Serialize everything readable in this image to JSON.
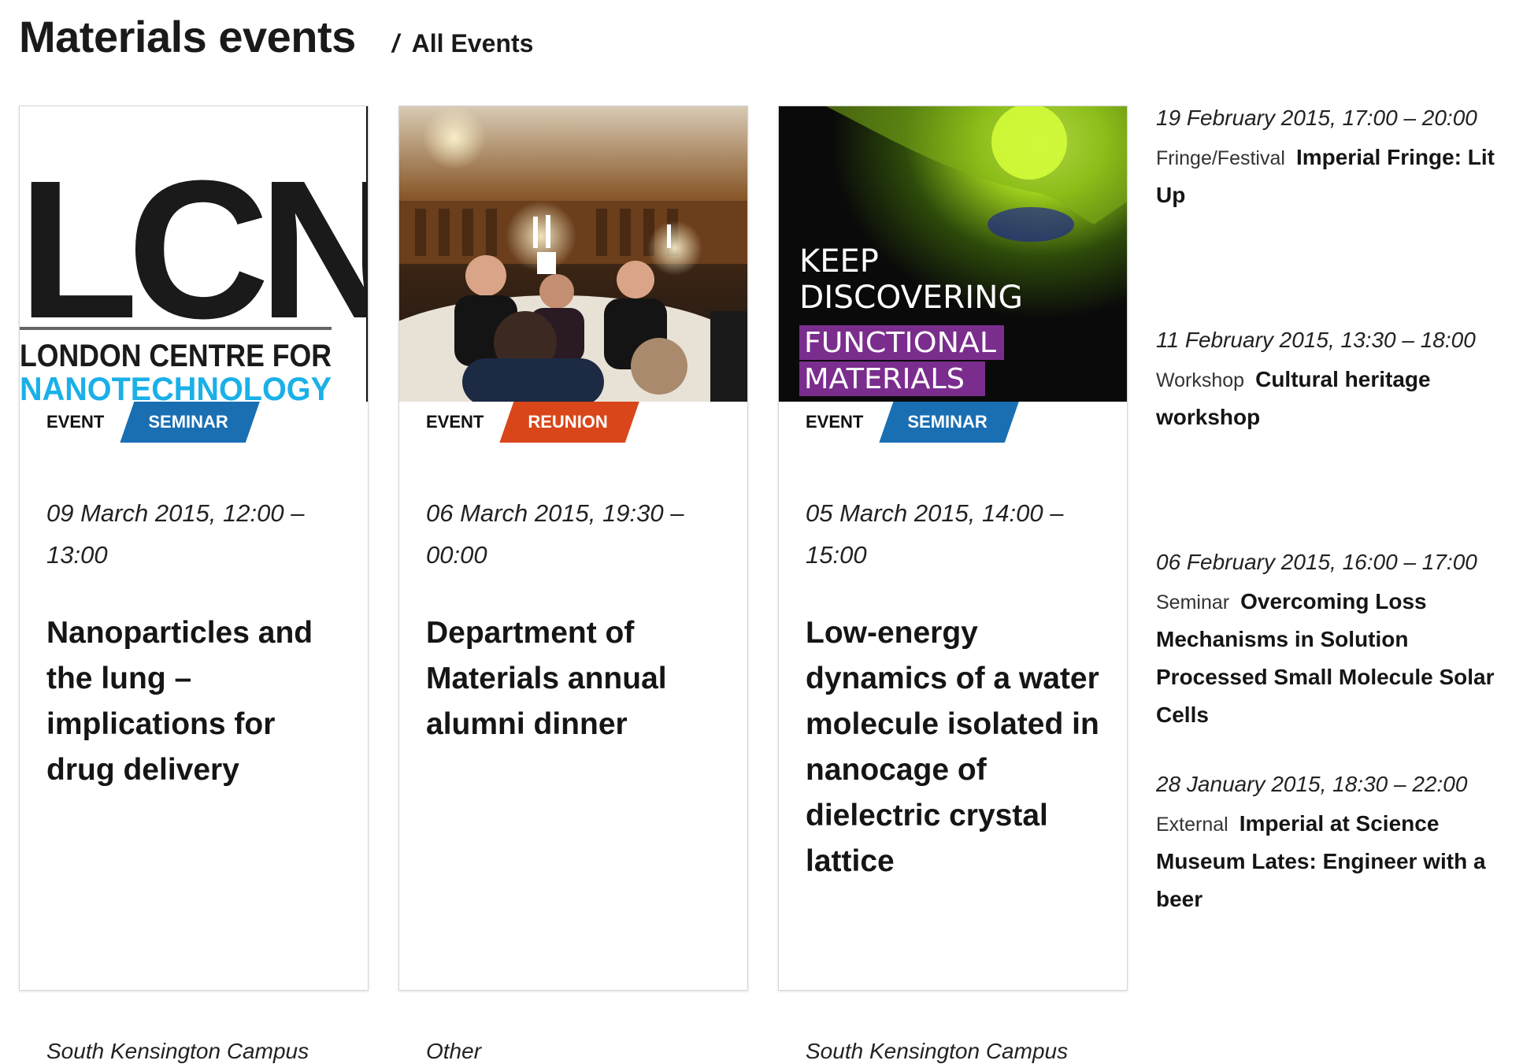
{
  "header": {
    "title": "Materials events",
    "separator": "/",
    "breadcrumb_link": "All Events"
  },
  "cards": [
    {
      "image_text": {
        "line1": "LCN",
        "line2": "LONDON CENTRE FOR",
        "line3": "NANOTECHNOLOGY"
      },
      "tag_event": "EVENT",
      "tag_type": "SEMINAR",
      "date": "09 March 2015, 12:00 – 13:00",
      "title": "Nanoparticles and the lung – implications for drug delivery",
      "location": "South Kensington Campus"
    },
    {
      "tag_event": "EVENT",
      "tag_type": "REUNION",
      "date": "06 March 2015, 19:30 – 00:00",
      "title": "Department of Materials annual alumni dinner",
      "location": "Other"
    },
    {
      "image_text": {
        "line1": "KEEP",
        "line2": "DISCOVERING",
        "line3": "FUNCTIONAL",
        "line4": "MATERIALS"
      },
      "tag_event": "EVENT",
      "tag_type": "SEMINAR",
      "date": "05 March 2015, 14:00 – 15:00",
      "title": "Low-energy dynamics of a water molecule isolated in nanocage of dielectric crystal lattice",
      "location": "South Kensington Campus"
    }
  ],
  "side_events": [
    {
      "date": "19 February 2015, 17:00 – 20:00",
      "category": "Fringe/Festival",
      "title": "Imperial Fringe: Lit Up"
    },
    {
      "date": "11 February 2015, 13:30 – 18:00",
      "category": "Workshop",
      "title": "Cultural heritage workshop"
    },
    {
      "date": "06 February 2015, 16:00 – 17:00",
      "category": "Seminar",
      "title": "Overcoming Loss Mechanisms in Solution Processed Small Molecule Solar Cells"
    },
    {
      "date": "28 January 2015, 18:30 – 22:00",
      "category": "External",
      "title": "Imperial at Science Museum Lates: Engineer with a beer"
    }
  ],
  "colors": {
    "seminar": "#1a6fb3",
    "reunion": "#d9461a",
    "lcn_blue": "#1ab0e8",
    "functional_purple": "#7b2d8e"
  }
}
